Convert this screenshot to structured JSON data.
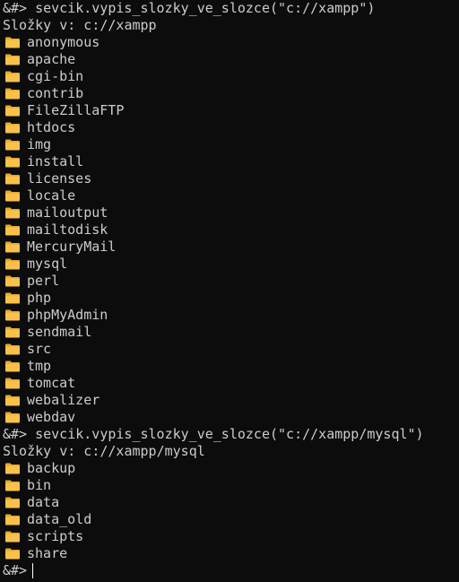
{
  "prompt": "&#>",
  "blocks": [
    {
      "command": "sevcik.vypis_slozky_ve_slozce(\"c://xampp\")",
      "header": "Složky v: c://xampp",
      "folders": [
        "anonymous",
        "apache",
        "cgi-bin",
        "contrib",
        "FileZillaFTP",
        "htdocs",
        "img",
        "install",
        "licenses",
        "locale",
        "mailoutput",
        "mailtodisk",
        "MercuryMail",
        "mysql",
        "perl",
        "php",
        "phpMyAdmin",
        "sendmail",
        "src",
        "tmp",
        "tomcat",
        "webalizer",
        "webdav"
      ]
    },
    {
      "command": "sevcik.vypis_slozky_ve_slozce(\"c://xampp/mysql\")",
      "header": "Složky v: c://xampp/mysql",
      "folders": [
        "backup",
        "bin",
        "data",
        "data_old",
        "scripts",
        "share"
      ]
    }
  ],
  "final_prompt": "&#>",
  "icon": "folder-icon",
  "colors": {
    "background": "#0c0c0c",
    "text": "#cccccc",
    "folder_fill": "#f8c24a",
    "folder_tab": "#e8a92c"
  }
}
